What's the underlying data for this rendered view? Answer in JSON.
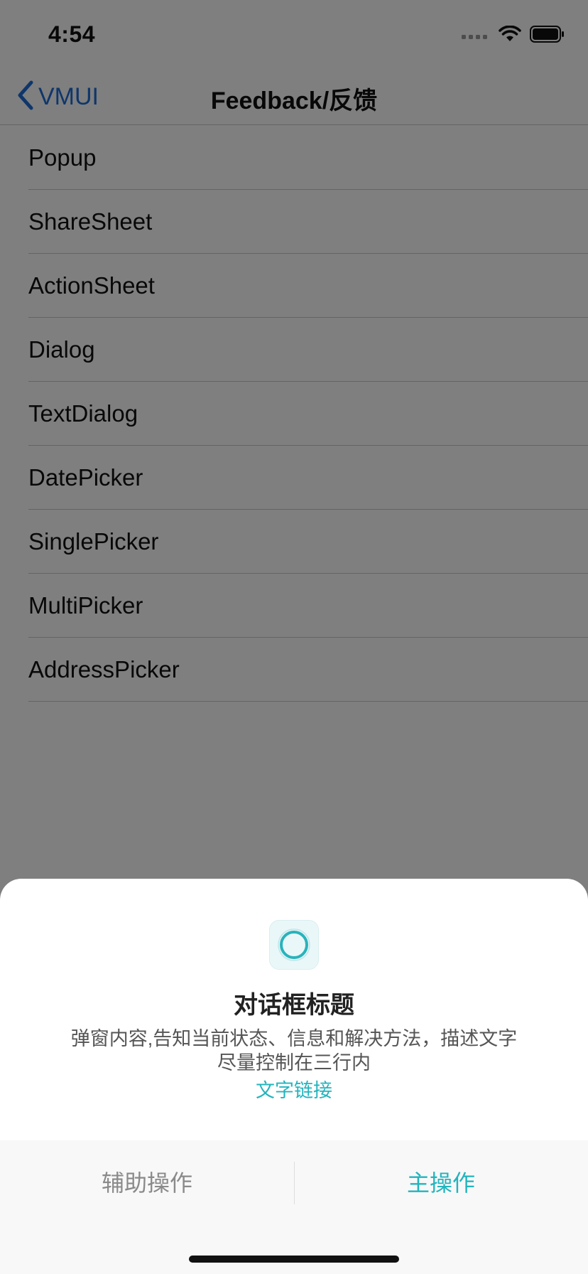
{
  "status_bar": {
    "time": "4:54"
  },
  "nav": {
    "back_label": "VMUI",
    "title": "Feedback/反馈"
  },
  "list": {
    "items": [
      {
        "label": "Popup"
      },
      {
        "label": "ShareSheet"
      },
      {
        "label": "ActionSheet"
      },
      {
        "label": "Dialog"
      },
      {
        "label": "TextDialog"
      },
      {
        "label": "DatePicker"
      },
      {
        "label": "SinglePicker"
      },
      {
        "label": "MultiPicker"
      },
      {
        "label": "AddressPicker"
      }
    ]
  },
  "dialog": {
    "logo_icon": "app-logo-icon",
    "title": "对话框标题",
    "content_line1": "弹窗内容,告知当前状态、信息和解决方法，描述文字",
    "content_line2": "尽量控制在三行内",
    "link": "文字链接",
    "secondary_action": "辅助操作",
    "primary_action": "主操作"
  },
  "colors": {
    "accent": "#23b4bd",
    "nav_tint": "#1f6dd6",
    "overlay": "rgba(0,0,0,0.5)"
  }
}
